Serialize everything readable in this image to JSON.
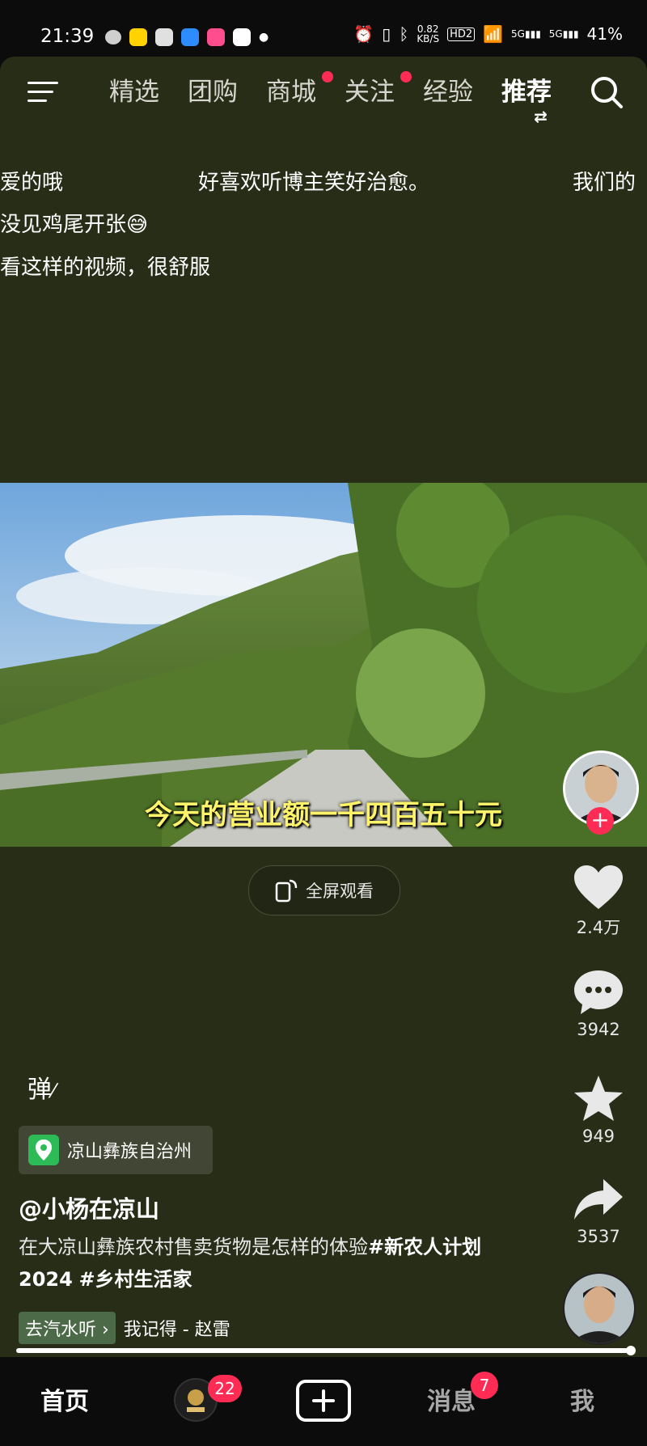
{
  "status_bar": {
    "time": "21:39",
    "net_speed_value": "0.82",
    "net_speed_unit": "KB/S",
    "hd_label": "HD2",
    "signal1": "5G",
    "signal2": "5G",
    "battery": "41%"
  },
  "top_nav": {
    "tabs": [
      {
        "label": "精选",
        "dot": false
      },
      {
        "label": "团购",
        "dot": false
      },
      {
        "label": "商城",
        "dot": true
      },
      {
        "label": "关注",
        "dot": true
      },
      {
        "label": "经验",
        "dot": false
      },
      {
        "label": "推荐",
        "dot": false,
        "active": true
      }
    ],
    "swap_icon": "swap-arrows-icon"
  },
  "danmaku": [
    "爱的哦",
    "好喜欢听博主笑好治愈。",
    "我们的",
    "没见鸡尾开张",
    "看这样的视频，很舒服"
  ],
  "video": {
    "subtitle": "今天的营业额一千四百五十元"
  },
  "fullscreen_label": "全屏观看",
  "actions": {
    "likes": "2.4万",
    "comments": "3942",
    "favorites": "949",
    "shares": "3537"
  },
  "danmu_toggle": "弹",
  "location": "凉山彝族自治州",
  "author": "@小杨在凉山",
  "caption": {
    "text": "在大凉山彝族农村售卖货物是怎样的体验",
    "tag1": "#新农人计划2024",
    "tag2": "#乡村生活家"
  },
  "music": {
    "chip": "去汽水听 ›",
    "song": "我记得 - 赵雷"
  },
  "bottom_nav": {
    "home": "首页",
    "friends_badge": "22",
    "messages": "消息",
    "messages_badge": "7",
    "me": "我"
  },
  "colors": {
    "accent": "#fe2c55",
    "bg": "#282d18",
    "subtitle": "#fff36a",
    "location_icon": "#2dbb57"
  }
}
